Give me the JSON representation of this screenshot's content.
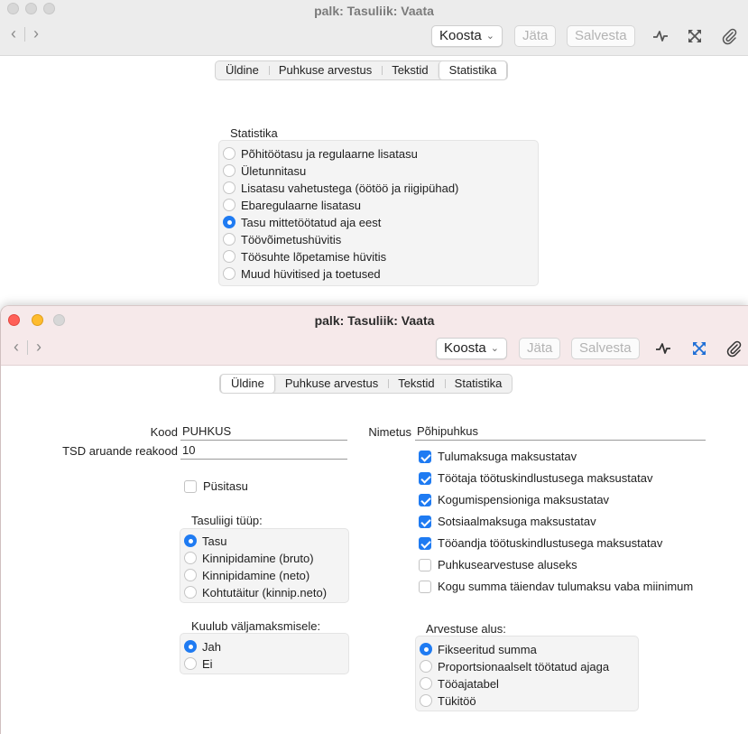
{
  "back_window": {
    "title": "palk: Tasuliik: Vaata",
    "toolbar": {
      "koosta": "Koosta",
      "jata": "Jäta",
      "salvesta": "Salvesta"
    },
    "tabs": [
      "Üldine",
      "Puhkuse arvestus",
      "Tekstid",
      "Statistika"
    ],
    "selected_tab": "Statistika",
    "statistika": {
      "label": "Statistika",
      "options": [
        "Põhitöötasu ja regulaarne lisatasu",
        "Ületunnitasu",
        "Lisatasu vahetustega (öötöö ja riigipühad)",
        "Ebaregulaarne lisatasu",
        "Tasu mittetöötatud aja eest",
        "Töövõimetushüvitis",
        "Töösuhte lõpetamise hüvitis",
        "Muud hüvitised ja toetused"
      ],
      "selected": "Tasu mittetöötatud aja eest"
    }
  },
  "front_window": {
    "title": "palk: Tasuliik: Vaata",
    "toolbar": {
      "koosta": "Koosta",
      "jata": "Jäta",
      "salvesta": "Salvesta"
    },
    "tabs": [
      "Üldine",
      "Puhkuse arvestus",
      "Tekstid",
      "Statistika"
    ],
    "selected_tab": "Üldine",
    "fields": {
      "kood_label": "Kood",
      "kood_value": "PUHKUS",
      "tsd_label": "TSD aruande reakood",
      "tsd_value": "10",
      "nimetus_label": "Nimetus",
      "nimetus_value": "Põhipuhkus"
    },
    "pusitasu": {
      "label": "Püsitasu",
      "checked": false
    },
    "checkboxes": [
      {
        "label": "Tulumaksuga maksustatav",
        "checked": true
      },
      {
        "label": "Töötaja töötuskindlustusega maksustatav",
        "checked": true
      },
      {
        "label": "Kogumispensioniga maksustatav",
        "checked": true
      },
      {
        "label": "Sotsiaalmaksuga maksustatav",
        "checked": true
      },
      {
        "label": "Tööandja töötuskindlustusega maksustatav",
        "checked": true
      },
      {
        "label": "Puhkusearvestuse aluseks",
        "checked": false
      },
      {
        "label": "Kogu summa täiendav tulumaksu vaba miinimum",
        "checked": false
      }
    ],
    "tasuliigi_tyyp": {
      "label": "Tasuliigi tüüp:",
      "options": [
        "Tasu",
        "Kinnipidamine (bruto)",
        "Kinnipidamine (neto)",
        "Kohtutäitur (kinnip.neto)"
      ],
      "selected": "Tasu"
    },
    "kuulub": {
      "label": "Kuulub väljamaksmisele:",
      "options": [
        "Jah",
        "Ei"
      ],
      "selected": "Jah"
    },
    "arvestuse_alus": {
      "label": "Arvestuse alus:",
      "options": [
        "Fikseeritud summa",
        "Proportsionaalselt töötatud ajaga",
        "Tööajatabel",
        "Tükitöö"
      ],
      "selected": "Fikseeritud summa"
    }
  },
  "icons": {
    "nav_back": "chevron-left-icon",
    "nav_forward": "chevron-right-icon",
    "activity": "activity-icon",
    "expand": "expand-icon",
    "attach": "paperclip-icon"
  },
  "colors": {
    "accent": "#1f7bf2",
    "front_titlebar": "#f6e9ea",
    "back_titlebar": "#ececec"
  }
}
